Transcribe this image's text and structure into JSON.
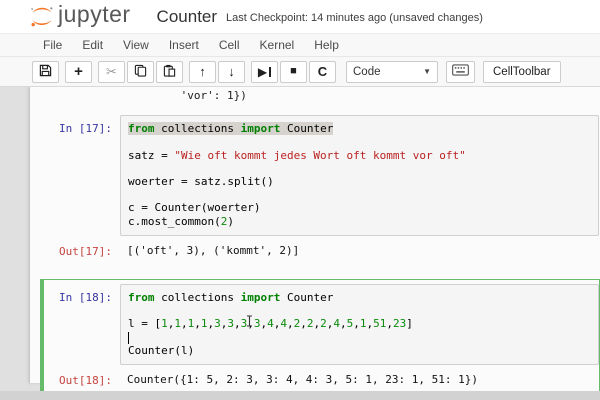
{
  "header": {
    "logo_text": "jupyter",
    "title": "Counter",
    "checkpoint": "Last Checkpoint: 14 minutes ago (unsaved changes)"
  },
  "menus": [
    "File",
    "Edit",
    "View",
    "Insert",
    "Cell",
    "Kernel",
    "Help"
  ],
  "toolbar": {
    "buttons": [
      {
        "name": "save-notebook-button",
        "icon": "floppy-icon",
        "glyph": "svg:floppy",
        "group": 0
      },
      {
        "name": "insert-cell-button",
        "icon": "plus-icon",
        "glyph": "+",
        "group": 1
      },
      {
        "name": "cut-cells-button",
        "icon": "scissors-icon",
        "glyph": "✂",
        "group": 2
      },
      {
        "name": "copy-cells-button",
        "icon": "copy-icon",
        "glyph": "svg:copy",
        "group": 2
      },
      {
        "name": "paste-cells-button",
        "icon": "paste-icon",
        "glyph": "svg:paste",
        "group": 2
      },
      {
        "name": "move-cell-up-button",
        "icon": "arrow-up-icon",
        "glyph": "↑",
        "group": 3
      },
      {
        "name": "move-cell-down-button",
        "icon": "arrow-down-icon",
        "glyph": "↓",
        "group": 3
      },
      {
        "name": "run-cell-button",
        "icon": "run-icon",
        "glyph": "▶",
        "group": 4
      },
      {
        "name": "interrupt-kernel-button",
        "icon": "stop-icon",
        "glyph": "■",
        "group": 4
      },
      {
        "name": "restart-kernel-button",
        "icon": "restart-icon",
        "glyph": "C",
        "group": 4
      }
    ],
    "cell_type_select": {
      "value": "Code"
    },
    "cell_toolbar_label": "CellToolbar"
  },
  "notebook": {
    "scroll_remnant": "         'vor': 1})",
    "cells": [
      {
        "in_prompt": "In [17]:",
        "out_prompt": "Out[17]:",
        "selected": false,
        "code": [
          {
            "hl": true,
            "tokens": [
              [
                "kw",
                "from"
              ],
              [
                "p",
                " collections "
              ],
              [
                "kw",
                "import"
              ],
              [
                "p",
                " Counter"
              ]
            ]
          },
          {
            "tokens": []
          },
          {
            "tokens": [
              [
                "p",
                "satz = "
              ],
              [
                "str",
                "\"Wie oft kommt jedes Wort oft kommt vor oft\""
              ]
            ]
          },
          {
            "tokens": []
          },
          {
            "tokens": [
              [
                "p",
                "woerter = satz.split()"
              ]
            ]
          },
          {
            "tokens": []
          },
          {
            "tokens": [
              [
                "p",
                "c = Counter(woerter)"
              ]
            ]
          },
          {
            "tokens": [
              [
                "p",
                "c.most_common("
              ],
              [
                "num",
                "2"
              ],
              [
                "p",
                ")"
              ]
            ]
          }
        ],
        "output": "[('oft', 3), ('kommt', 2)]"
      },
      {
        "in_prompt": "In [18]:",
        "out_prompt": "Out[18]:",
        "selected": true,
        "code": [
          {
            "tokens": [
              [
                "kw",
                "from"
              ],
              [
                "p",
                " collections "
              ],
              [
                "kw",
                "import"
              ],
              [
                "p",
                " Counter"
              ]
            ]
          },
          {
            "tokens": []
          },
          {
            "tokens": [
              [
                "p",
                "l = ["
              ],
              [
                "numlist",
                "1,1,1,1,3,3,3,3,4,4,2,2,2,4,5,1,51,23"
              ],
              [
                "p",
                "]"
              ]
            ]
          },
          {
            "cursor": true,
            "tokens": []
          },
          {
            "tokens": [
              [
                "p",
                "Counter(l)"
              ]
            ]
          }
        ],
        "output": "Counter({1: 5, 2: 3, 3: 4, 4: 3, 5: 1, 23: 1, 51: 1})"
      }
    ]
  },
  "colors": {
    "brand_orange": "#F37626",
    "edit_mode_green": "#66BB6A",
    "in_prompt_navy": "#3637a0",
    "out_prompt_red": "#c5443e",
    "keyword_green": "#008000",
    "string_red": "#BA2121",
    "number_green": "#0a8a0a"
  }
}
